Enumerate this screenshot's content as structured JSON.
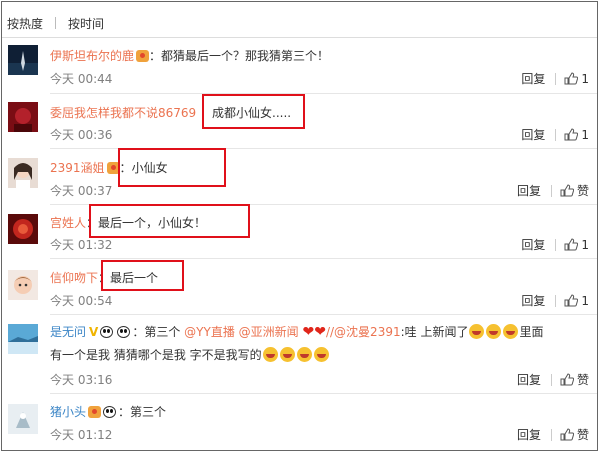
{
  "sort": {
    "hot": "按热度",
    "time": "按时间"
  },
  "comments": [
    {
      "user": "伊斯坦布尔的鹿",
      "colon": "：",
      "text": "都猜最后一个？那我猜第三个！",
      "time": "今天 00:44",
      "reply": "回复",
      "like": "1"
    },
    {
      "user": "委屈我怎样我都不说86769",
      "colon": "：",
      "text": "成都小仙女.....",
      "time": "今天 00:36",
      "reply": "回复",
      "like": "1"
    },
    {
      "user": "2391涵姐",
      "colon": "：",
      "text": "小仙女",
      "time": "今天 00:37",
      "reply": "回复",
      "like": "赞"
    },
    {
      "user": "宫姓人",
      "colon": "：",
      "text": "最后一个，小仙女！",
      "time": "今天 01:32",
      "reply": "回复",
      "like": "1"
    },
    {
      "user": "信仰吻下",
      "colon": "：",
      "text": "最后一个",
      "time": "今天 00:54",
      "reply": "回复",
      "like": "1"
    },
    {
      "user": "是无问",
      "colon": "：",
      "text_a": "第三个 ",
      "mention1": "@YY直播",
      "mention2": "@亚洲新闻",
      "mention3": "//@沈曼2391",
      "text_b": ":哇 上新闻了",
      "text_c": "里面",
      "line2": "有一个是我 猜猜哪个是我 字不是我写的",
      "time": "今天 03:16",
      "reply": "回复",
      "like": "赞"
    },
    {
      "user": "猪小头",
      "colon": "：",
      "text": "第三个",
      "time": "今天 01:12",
      "reply": "回复",
      "like": "赞"
    }
  ],
  "colors": {
    "username": "#eb7350",
    "highlight_box": "#e0101a",
    "time": "#808080"
  }
}
